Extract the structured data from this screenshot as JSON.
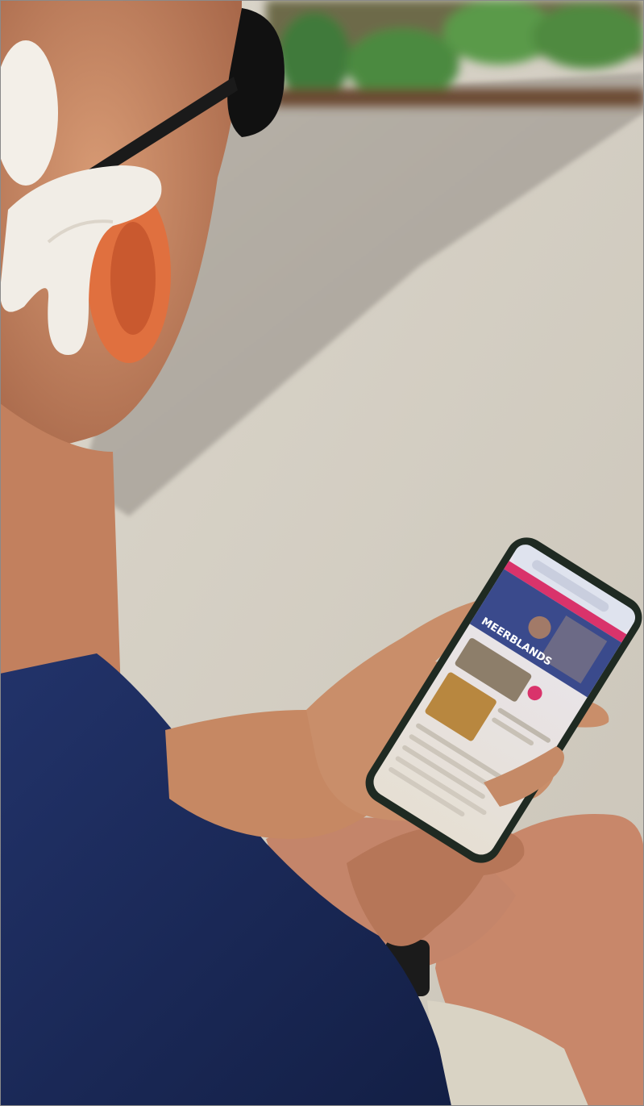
{
  "photo": {
    "subject": "person-with-bone-conduction-hearing-device-using-smartphone",
    "setting": "outdoor-path-with-gravel-and-plants"
  },
  "phone_screen": {
    "banner_heading": "MEERBLANDS",
    "accent_color": "#d9336b",
    "primary_color": "#3a4a8c"
  },
  "colors": {
    "shirt": "#1a2a5a",
    "skin": "#c98b66",
    "concrete": "#d4cfc4",
    "gravel": "#b9b4ac",
    "foliage": "#3f7a3a",
    "device": "#f1ede6",
    "phone_case": "#1f2a22"
  }
}
